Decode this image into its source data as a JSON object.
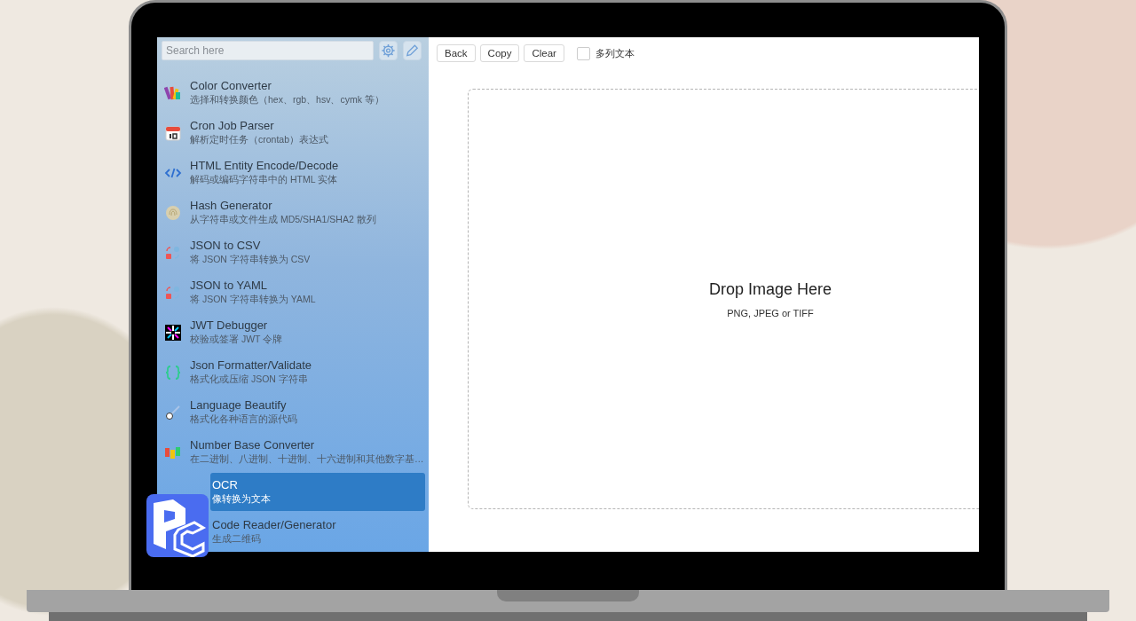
{
  "sidebar": {
    "search": {
      "placeholder": "Search here"
    },
    "items": [
      {
        "title": "Color Converter",
        "subtitle": "选择和转换颜色（hex、rgb、hsv、cymk 等）",
        "selected": false
      },
      {
        "title": "Cron Job Parser",
        "subtitle": "解析定时任务（crontab）表达式",
        "selected": false
      },
      {
        "title": "HTML Entity Encode/Decode",
        "subtitle": "解码或编码字符串中的 HTML 实体",
        "selected": false
      },
      {
        "title": "Hash Generator",
        "subtitle": "从字符串或文件生成 MD5/SHA1/SHA2 散列",
        "selected": false
      },
      {
        "title": "JSON to CSV",
        "subtitle": "将 JSON 字符串转换为 CSV",
        "selected": false
      },
      {
        "title": "JSON to YAML",
        "subtitle": "将 JSON 字符串转换为 YAML",
        "selected": false
      },
      {
        "title": "JWT Debugger",
        "subtitle": "校验或签署 JWT 令牌",
        "selected": false
      },
      {
        "title": "Json Formatter/Validate",
        "subtitle": "格式化或压缩 JSON 字符串",
        "selected": false
      },
      {
        "title": "Language Beautify",
        "subtitle": "格式化各种语言的源代码",
        "selected": false
      },
      {
        "title": "Number Base Converter",
        "subtitle": "在二进制、八进制、十进制、十六进制和其他数字基…",
        "selected": false
      },
      {
        "title": "OCR",
        "subtitle": "像转换为文本",
        "selected": true,
        "overlaid": true
      },
      {
        "title": "Code Reader/Generator",
        "subtitle": "生成二维码",
        "selected": false,
        "overlaid": true
      }
    ]
  },
  "toolbar": {
    "buttons": [
      "Back",
      "Copy",
      "Clear"
    ],
    "checkbox": {
      "label": "多列文本",
      "checked": false
    }
  },
  "drop_zone": {
    "title": "Drop Image Here",
    "hint": "PNG, JPEG or TIFF"
  }
}
